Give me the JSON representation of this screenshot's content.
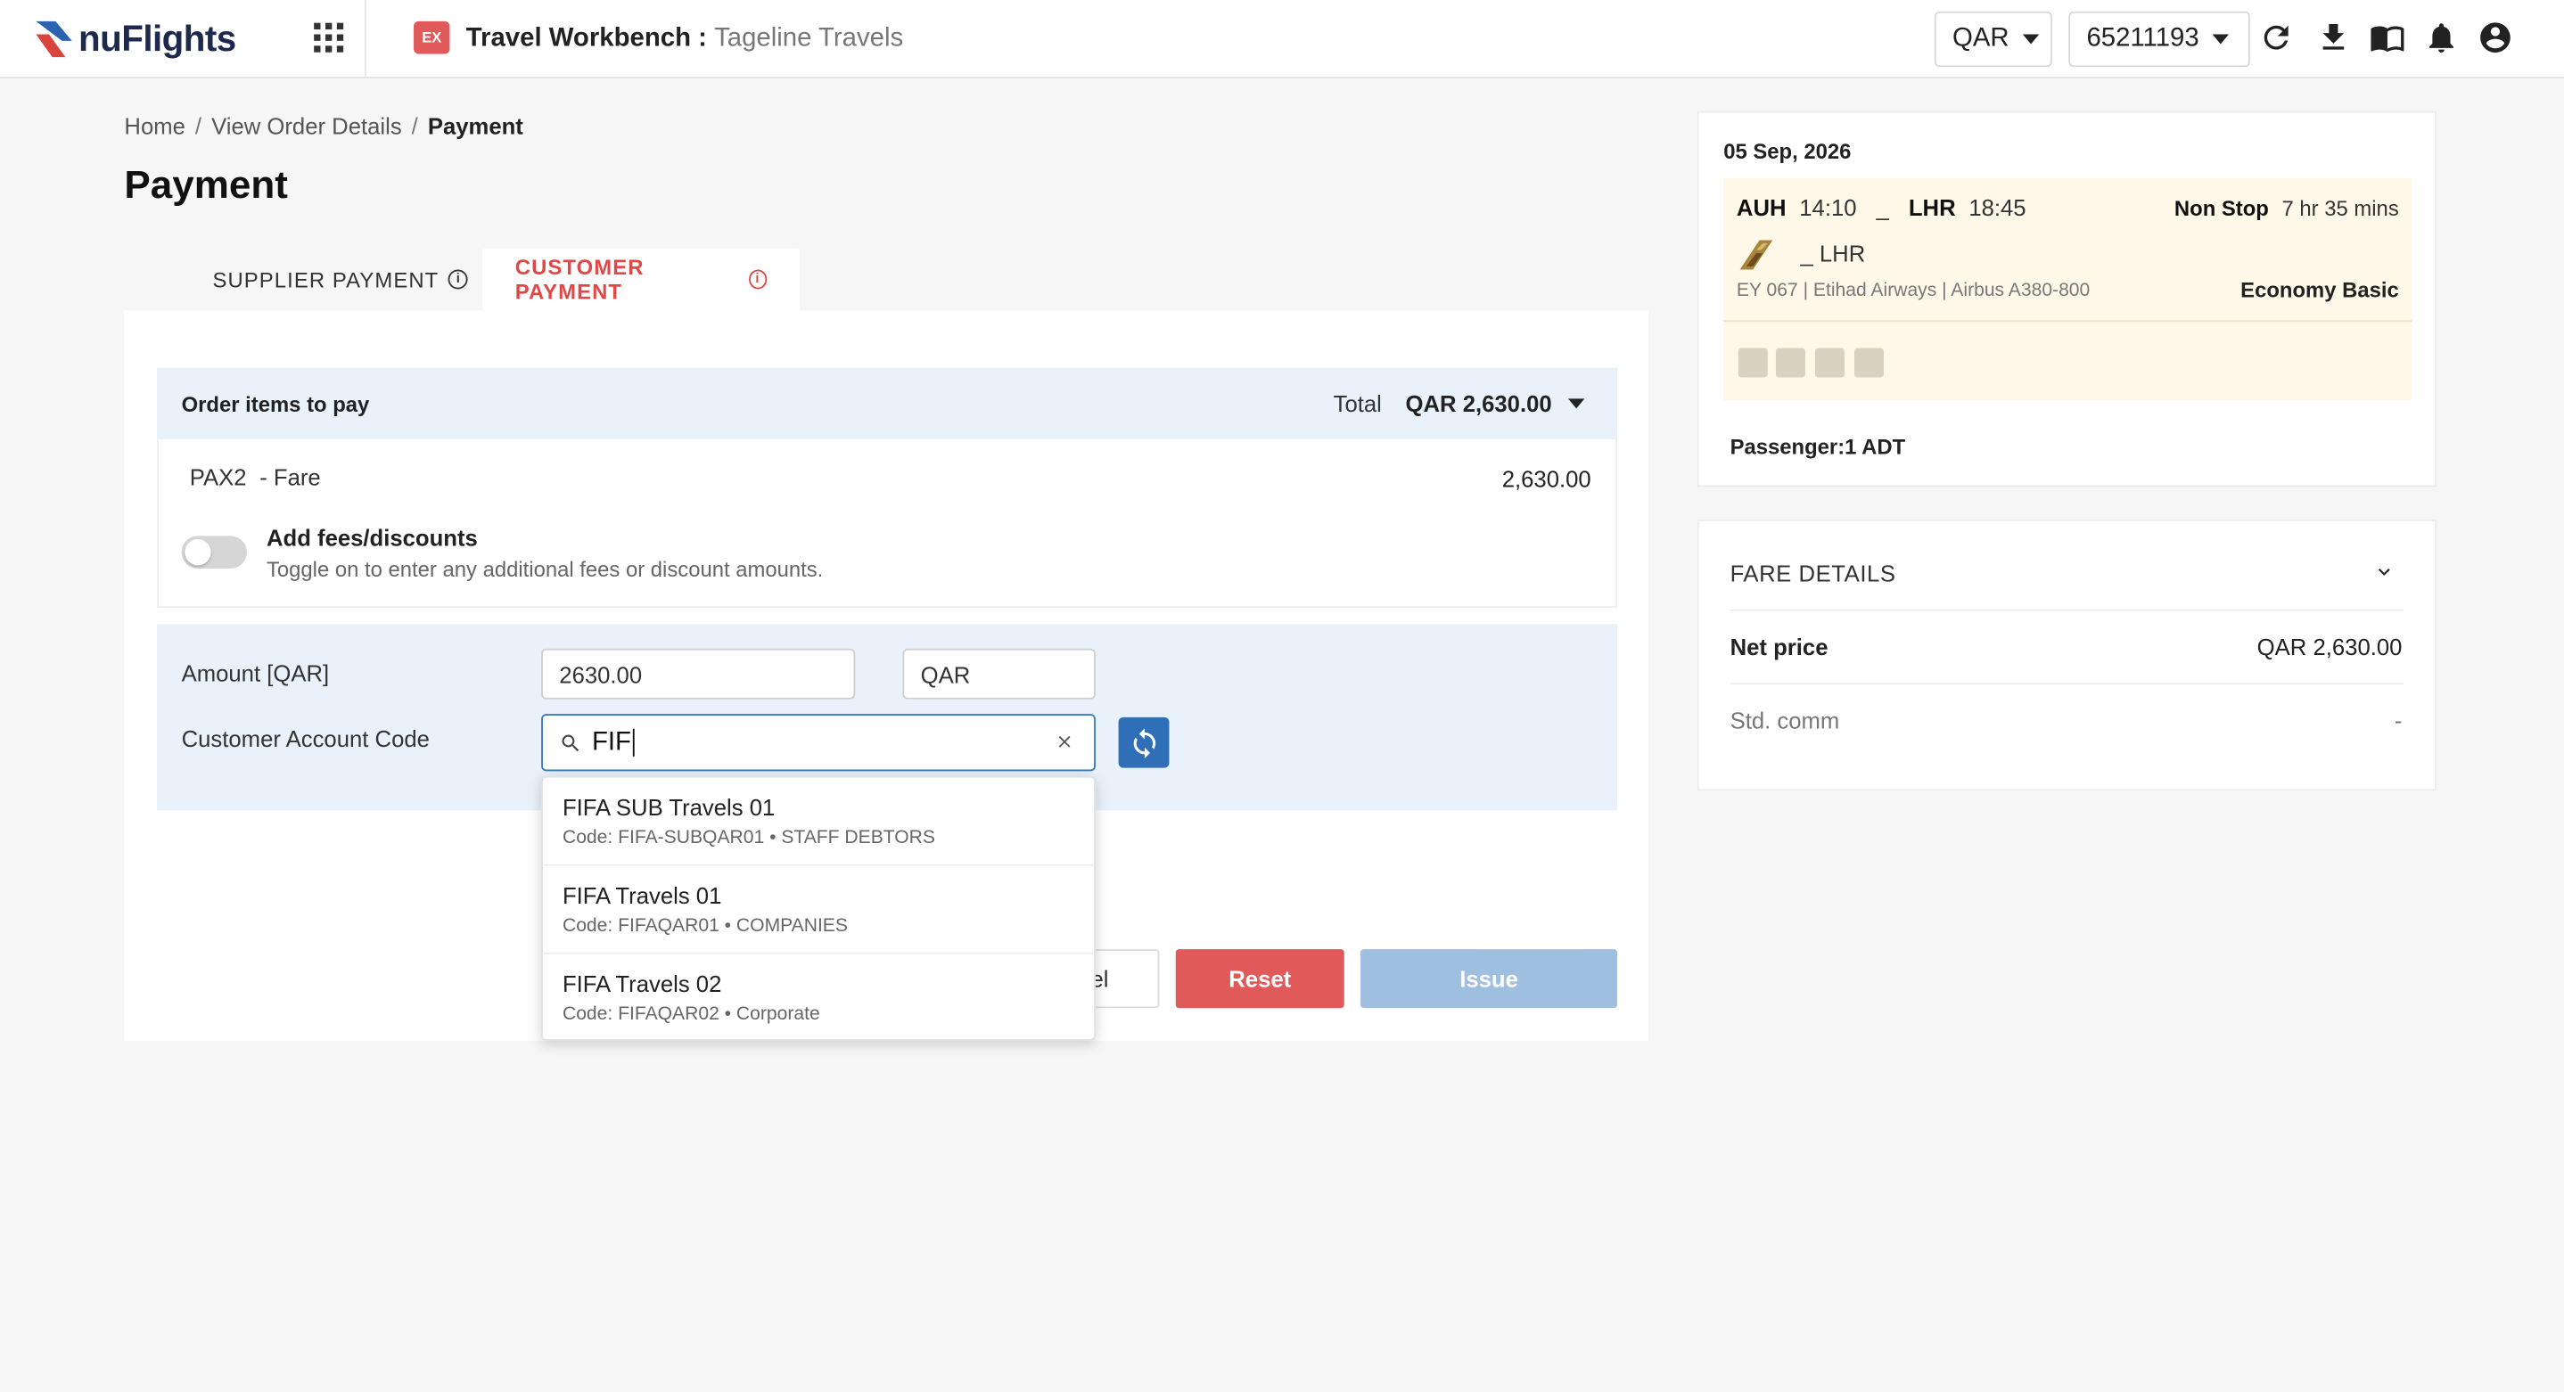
{
  "header": {
    "brand": "nuFlights",
    "workbench_icon": "EX",
    "workbench_title": "Travel Workbench :",
    "workbench_subtitle": "Tageline Travels",
    "currency": "QAR",
    "account": "65211193"
  },
  "breadcrumb": {
    "home": "Home",
    "order": "View Order Details",
    "current": "Payment"
  },
  "page_title": "Payment",
  "tabs": {
    "supplier": "SUPPLIER PAYMENT",
    "customer": "CUSTOMER PAYMENT"
  },
  "order": {
    "heading": "Order items to pay",
    "total_label": "Total",
    "total_value": "QAR 2,630.00",
    "pax_id": "PAX2",
    "pax_item": "- Fare",
    "fare_amount": "2,630.00",
    "fees_title": "Add fees/discounts",
    "fees_desc": "Toggle on to enter any additional fees or discount amounts."
  },
  "payment": {
    "amount_label": "Amount [QAR]",
    "amount_value": "2630.00",
    "currency_value": "QAR",
    "account_label": "Customer Account Code",
    "search_value": "FIF"
  },
  "dropdown": [
    {
      "name": "FIFA SUB Travels 01",
      "code": "Code: FIFA-SUBQAR01 • STAFF DEBTORS"
    },
    {
      "name": "FIFA Travels 01",
      "code": "Code: FIFAQAR01 • COMPANIES"
    },
    {
      "name": "FIFA Travels 02",
      "code": "Code: FIFAQAR02 • Corporate"
    }
  ],
  "buttons": {
    "cancel": "el",
    "reset": "Reset",
    "issue": "Issue"
  },
  "flight": {
    "date": "05 Sep, 2026",
    "from": "AUH",
    "dep_time": "14:10",
    "dash": "_",
    "to": "LHR",
    "arr_time": "18:45",
    "stops": "Non Stop",
    "duration": "7 hr 35 mins",
    "via": "_  LHR",
    "info": "EY 067 | Etihad Airways | Airbus A380-800",
    "cabin": "Economy Basic",
    "passengers": "Passenger:1 ADT"
  },
  "fare_details": {
    "title": "FARE DETAILS",
    "net_label": "Net price",
    "net_value": "QAR 2,630.00",
    "comm_label": "Std. comm",
    "comm_value": "-"
  },
  "colors": {
    "accent_red": "#e05a5a",
    "primary_blue": "#2f6fb8",
    "disabled_blue": "#9fbfe0",
    "panel_blue": "#e9f1fa",
    "flight_bg": "#fdf8e8"
  },
  "icons": [
    "apps-grid-icon",
    "workbench-icon",
    "refresh-icon",
    "download-icon",
    "book-icon",
    "bell-icon",
    "account-icon",
    "info-icon",
    "search-icon",
    "clear-icon",
    "sync-icon",
    "chevron-down-icon"
  ]
}
